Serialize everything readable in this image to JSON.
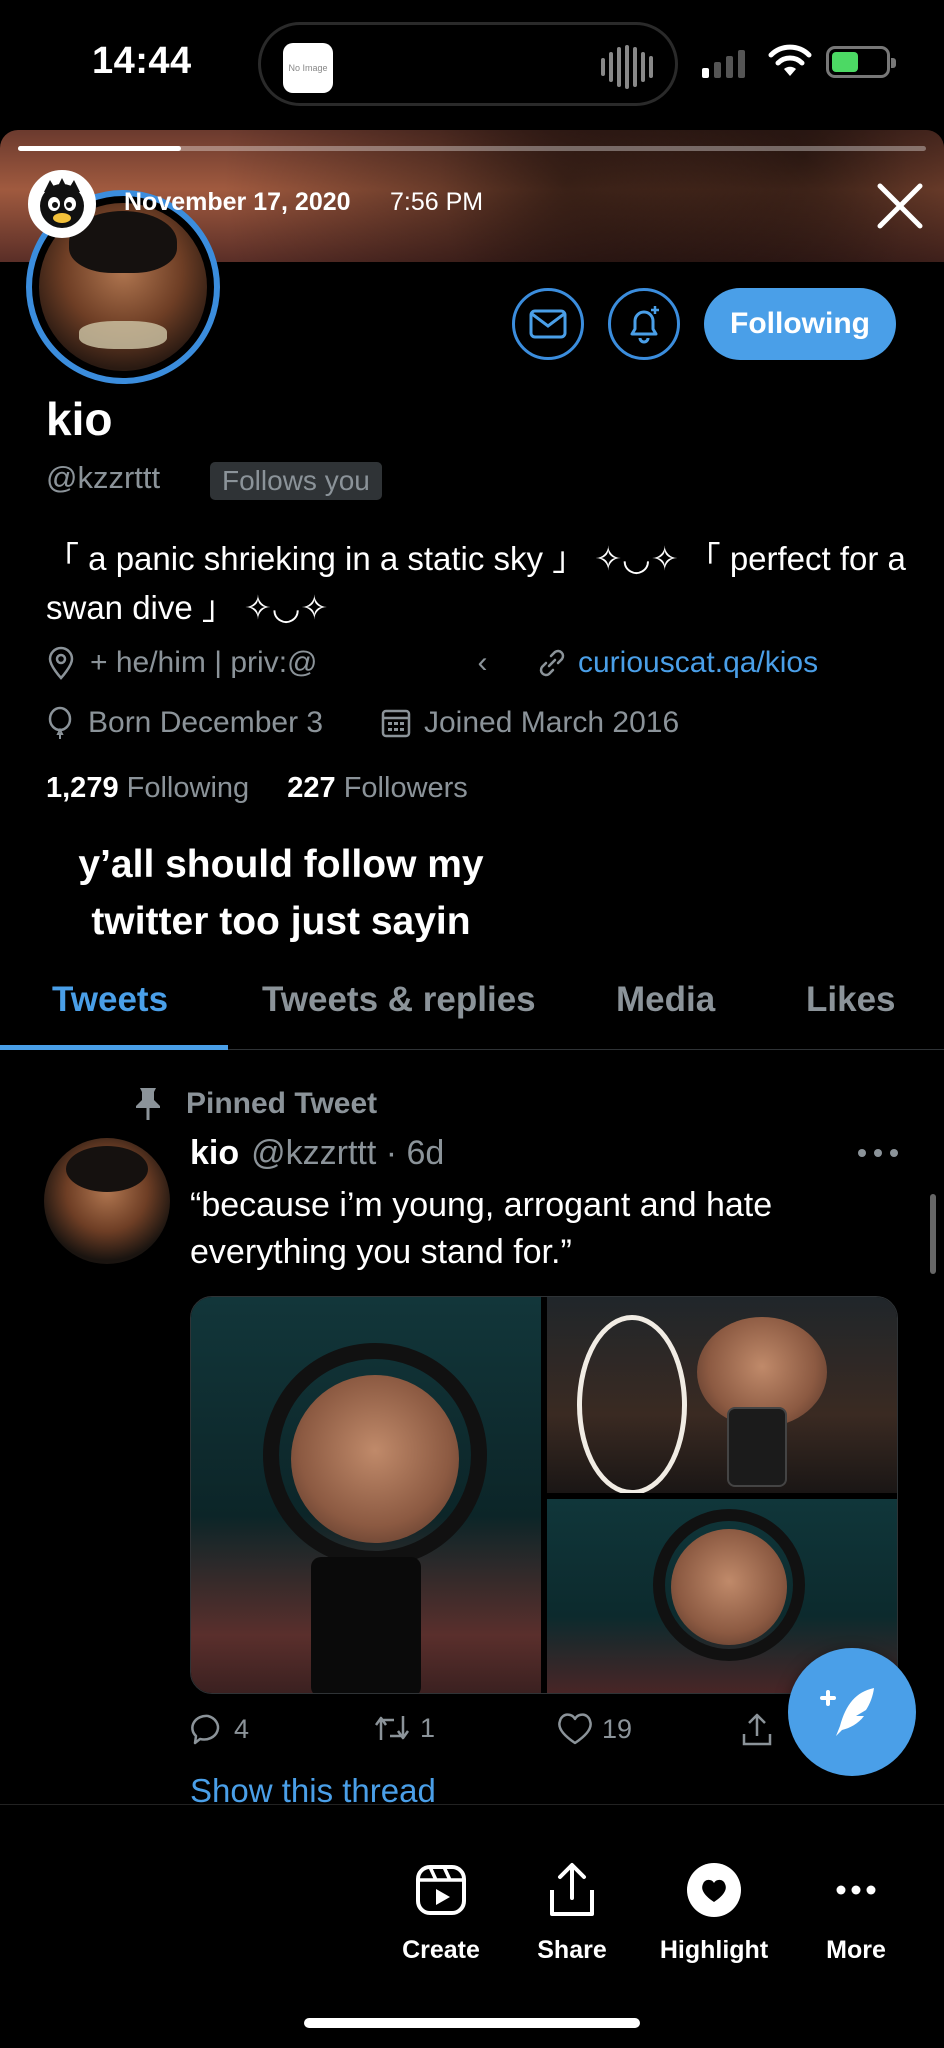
{
  "status_bar": {
    "time": "14:44",
    "island_app_label": "No Image"
  },
  "story": {
    "progress_fraction": 0.18,
    "date": "November 17, 2020",
    "time": "7:56 PM",
    "caption_line1": "y’all should follow my",
    "caption_line2": "twitter too just sayin"
  },
  "profile": {
    "name": "kio",
    "handle": "@kzzrttt",
    "follows_badge": "Follows you",
    "following_button": "Following",
    "bio": "「 a panic shrieking in a static sky 」 ✧◡✧ 「 perfect for a swan dive 」 ✧◡✧",
    "location": "+ he/him | priv:@",
    "location_hidden": "‹",
    "link": "curiouscat.qa/kios",
    "birthday": "Born December 3",
    "joined": "Joined March 2016",
    "following_count": "1,279",
    "following_label": "Following",
    "followers_count": "227",
    "followers_label": "Followers"
  },
  "tabs": [
    "Tweets",
    "Tweets & replies",
    "Media",
    "Likes"
  ],
  "active_tab": "Tweets",
  "tweet": {
    "pinned_label": "Pinned Tweet",
    "name": "kio",
    "handle": "@kzzrttt · 6d",
    "text": "“because i’m young, arrogant and hate everything you stand for.”",
    "replies": "4",
    "retweets": "1",
    "likes": "19",
    "show_thread": "Show this thread"
  },
  "bottom_bar": {
    "create": "Create",
    "share": "Share",
    "highlight": "Highlight",
    "more": "More"
  },
  "colors": {
    "accent": "#4a9fe8",
    "muted_text": "#8b9399",
    "background": "#000000"
  },
  "icons": [
    "mail-icon",
    "bell-plus-icon",
    "location-pin-icon",
    "link-icon",
    "balloon-icon",
    "calendar-icon",
    "pin-icon",
    "reply-icon",
    "retweet-icon",
    "like-icon",
    "share-icon",
    "compose-feather-icon",
    "create-reel-icon",
    "upload-share-icon",
    "heart-highlight-icon",
    "more-dots-icon",
    "close-icon"
  ]
}
